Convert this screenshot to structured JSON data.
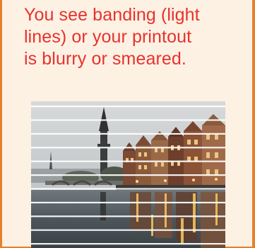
{
  "headline": {
    "lines": [
      "You see banding (light",
      "lines) or your printout",
      "is blurry or smeared."
    ]
  },
  "photo": {
    "icon": "canal-street-photo-with-banding",
    "band_count": 11
  },
  "colors": {
    "headline": "#e8322b",
    "border": "#e7802c",
    "background": "#fdf1e4"
  }
}
